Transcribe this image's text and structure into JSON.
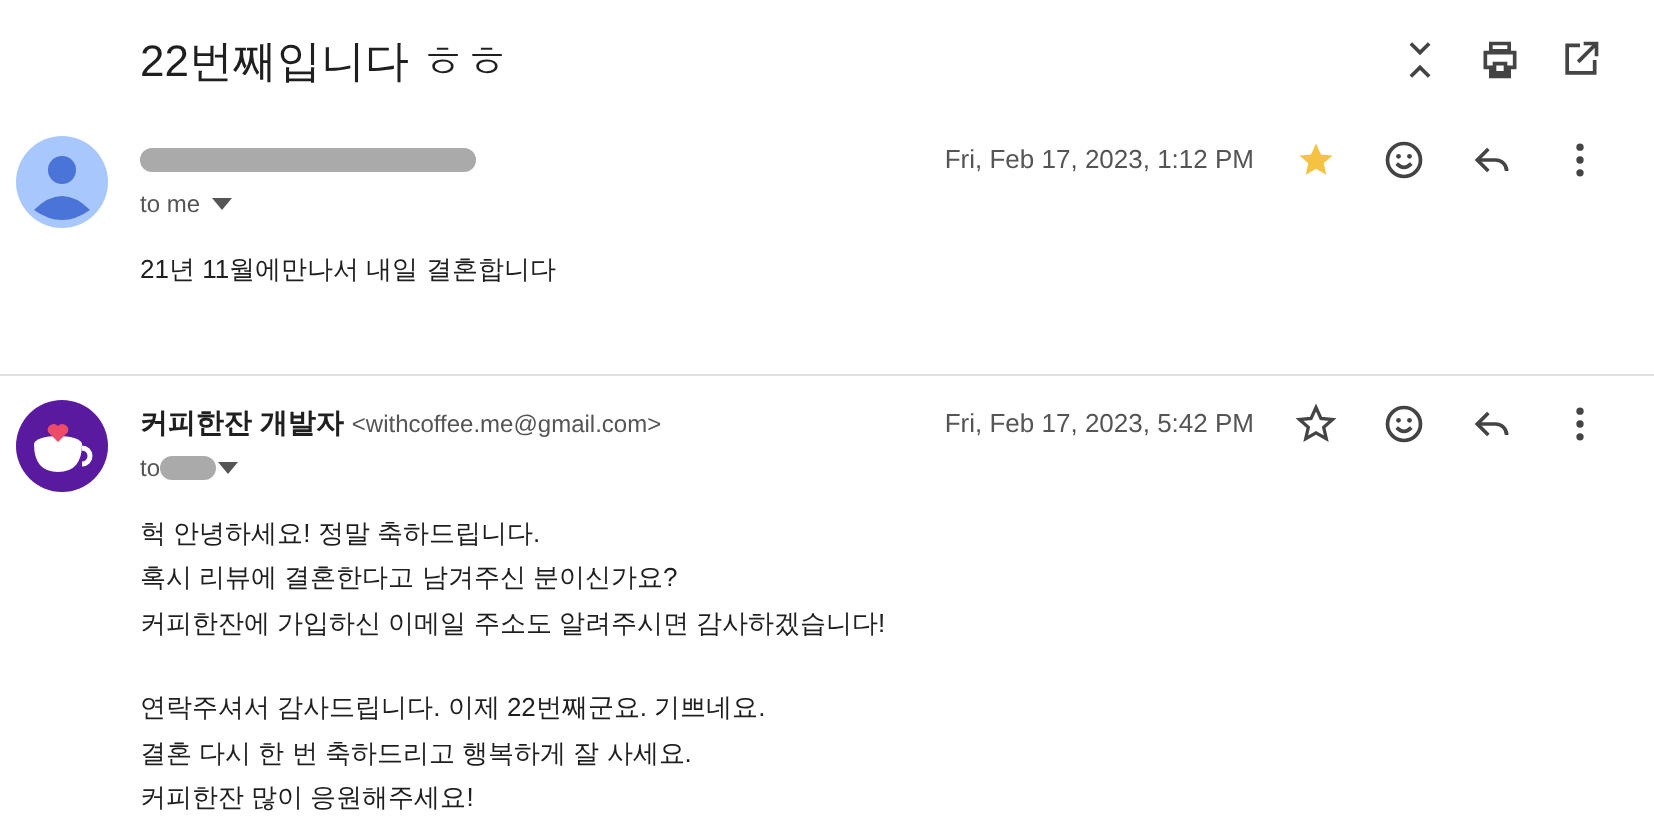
{
  "subject": "22번째입니다 ㅎㅎ",
  "messages": [
    {
      "recipient": "to me",
      "recipient_redacted": false,
      "kind": "person",
      "date": "Fri, Feb 17, 2023, 1:12 PM",
      "starred": true,
      "name_redacted": true,
      "paragraphs": [
        [
          "21년 11월에만나서 내일 결혼합니다"
        ]
      ]
    },
    {
      "sender_name": "커피한잔 개발자",
      "sender_email": "<withcoffee.me@gmail.com>",
      "recipient": "to",
      "recipient_redacted": true,
      "kind": "cup",
      "date": "Fri, Feb 17, 2023, 5:42 PM",
      "starred": false,
      "name_redacted": false,
      "paragraphs": [
        [
          "헉 안녕하세요! 정말 축하드립니다.",
          "혹시 리뷰에 결혼한다고 남겨주신 분이신가요?",
          "커피한잔에 가입하신 이메일 주소도 알려주시면 감사하겠습니다!"
        ],
        [
          "연락주셔서 감사드립니다. 이제 22번째군요. 기쁘네요.",
          "결혼 다시 한 번 축하드리고 행복하게 잘 사세요.",
          "커피한잔 많이 응원해주세요!"
        ]
      ]
    }
  ]
}
